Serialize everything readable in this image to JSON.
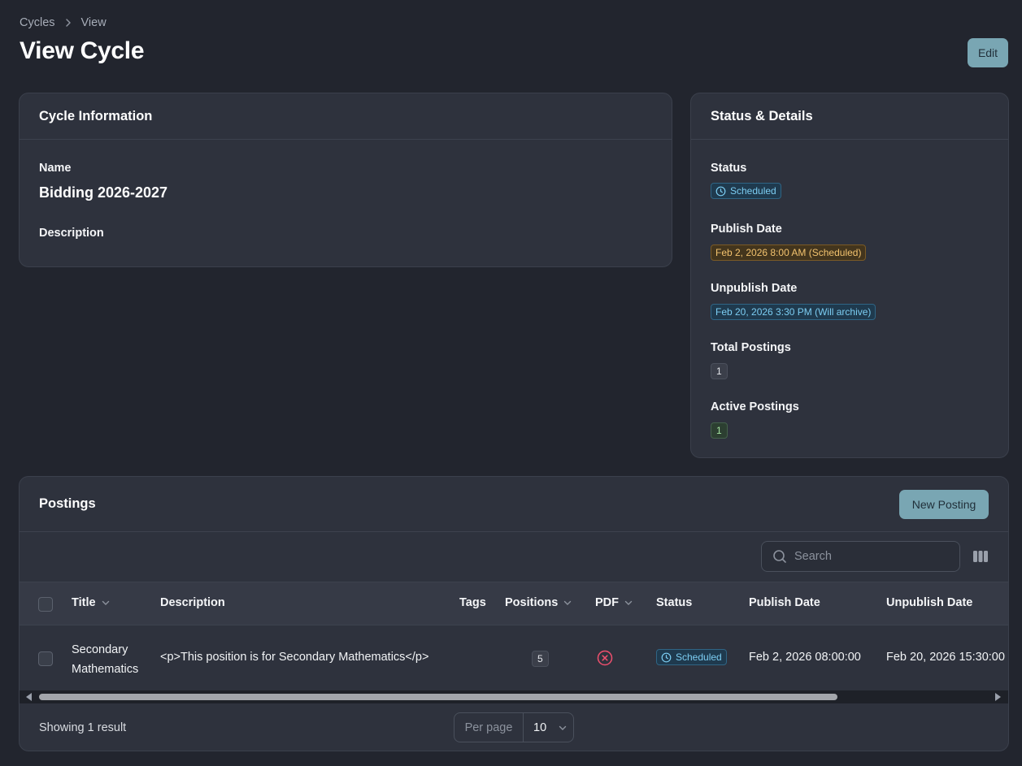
{
  "breadcrumb": {
    "items": [
      "Cycles",
      "View"
    ]
  },
  "page": {
    "title": "View Cycle",
    "edit_label": "Edit"
  },
  "info": {
    "header": "Cycle Information",
    "name_label": "Name",
    "name_value": "Bidding 2026-2027",
    "description_label": "Description"
  },
  "status_card": {
    "header": "Status & Details",
    "status_label": "Status",
    "status_value": "Scheduled",
    "publish_label": "Publish Date",
    "publish_value": "Feb 2, 2026 8:00 AM (Scheduled)",
    "unpublish_label": "Unpublish Date",
    "unpublish_value": "Feb 20, 2026 3:30 PM (Will archive)",
    "total_label": "Total Postings",
    "total_value": "1",
    "active_label": "Active Postings",
    "active_value": "1"
  },
  "postings": {
    "header": "Postings",
    "new_label": "New Posting",
    "search_placeholder": "Search",
    "columns": {
      "title": "Title",
      "description": "Description",
      "tags": "Tags",
      "positions": "Positions",
      "pdf": "PDF",
      "status": "Status",
      "publish_date": "Publish Date",
      "unpublish_date": "Unpublish Date"
    },
    "rows": [
      {
        "title_line1": "Secondary",
        "title_line2": "Mathematics",
        "description": "<p>This position is for Secondary Mathematics</p>",
        "positions": "5",
        "status": "Scheduled",
        "publish_date": "Feb 2, 2026 08:00:00",
        "unpublish_date": "Feb 20, 2026 15:30:00"
      }
    ],
    "footer_text": "Showing 1 result",
    "per_page_label": "Per page",
    "per_page_value": "10"
  },
  "colors": {
    "background": "#22252e",
    "card": "#2e323d",
    "accent_button": "#79a6b3",
    "badge_blue": "#7ccdf2",
    "badge_amber": "#f2c26e",
    "badge_green": "#a6e3a1",
    "pdf_missing": "#f0506e"
  }
}
